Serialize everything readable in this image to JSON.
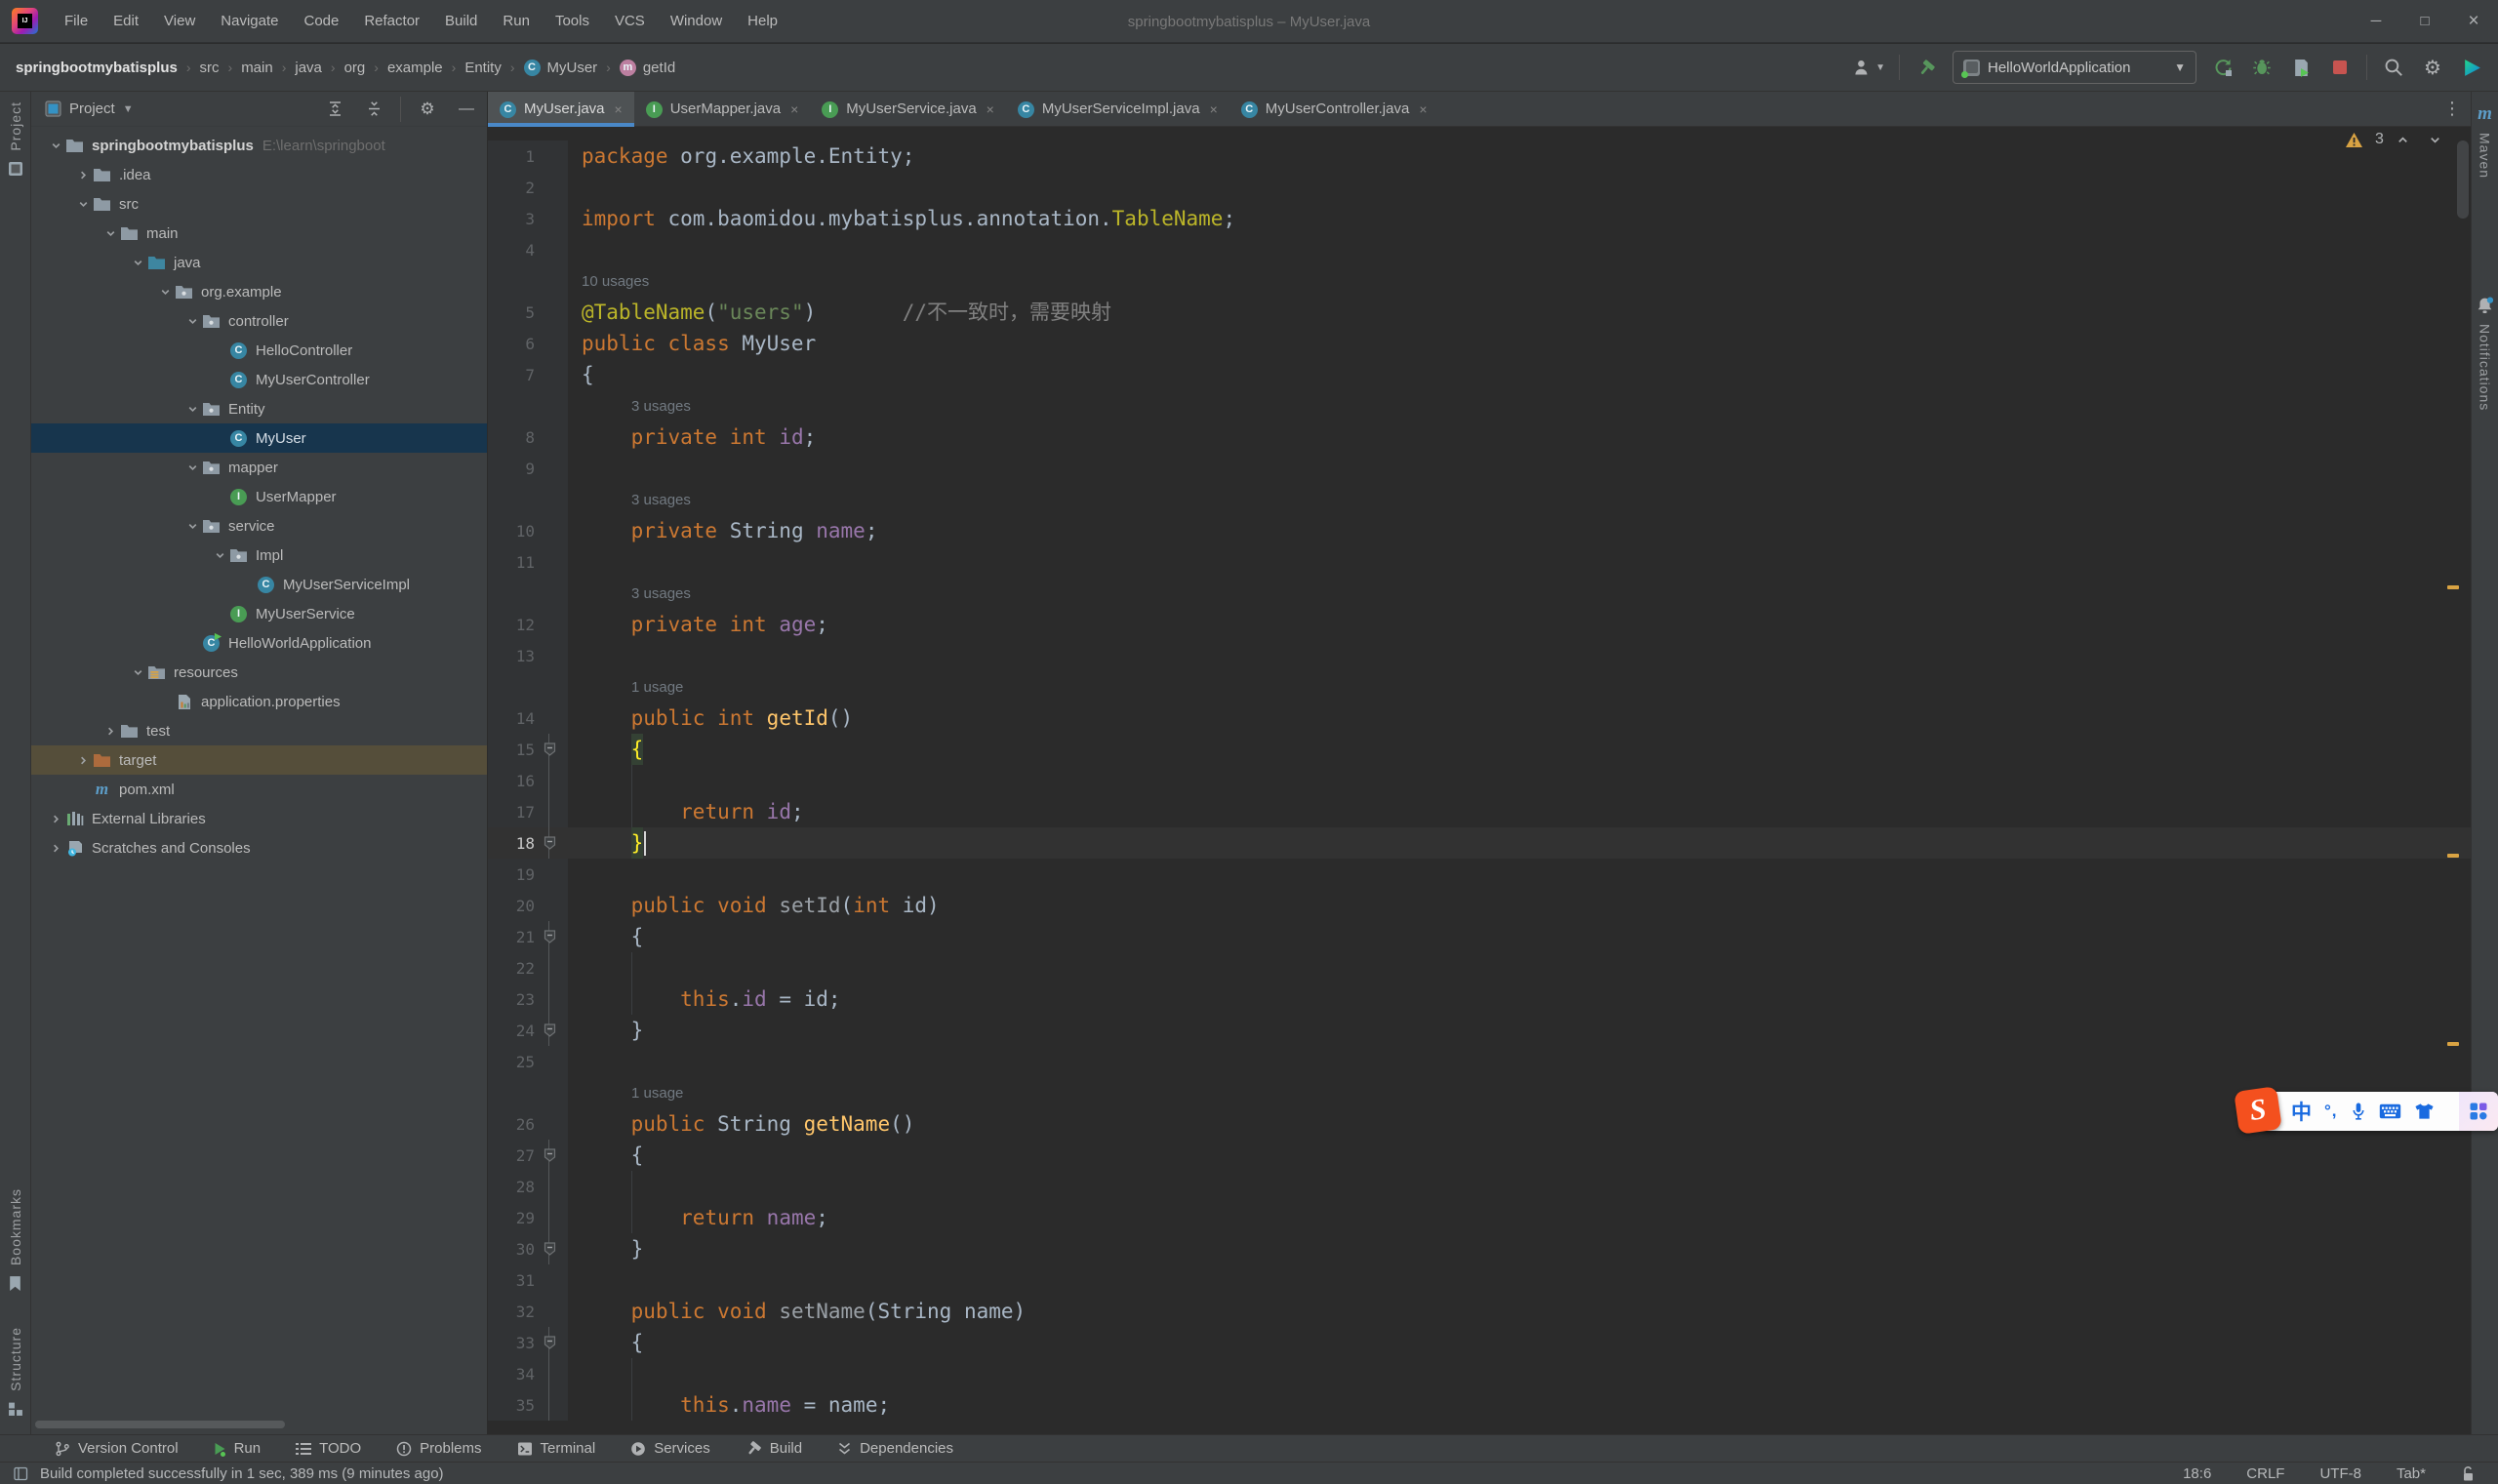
{
  "window": {
    "title": "springbootmybatisplus – MyUser.java",
    "menu": [
      "File",
      "Edit",
      "View",
      "Navigate",
      "Code",
      "Refactor",
      "Build",
      "Run",
      "Tools",
      "VCS",
      "Window",
      "Help"
    ],
    "controls": [
      {
        "name": "minimize",
        "glyph": "─"
      },
      {
        "name": "maximize",
        "glyph": "□"
      },
      {
        "name": "close",
        "glyph": "×"
      }
    ]
  },
  "breadcrumbs": [
    {
      "label": "springbootmybatisplus",
      "bold": true
    },
    {
      "label": "src"
    },
    {
      "label": "main"
    },
    {
      "label": "java"
    },
    {
      "label": "org"
    },
    {
      "label": "example"
    },
    {
      "label": "Entity"
    },
    {
      "label": "MyUser",
      "icon": "class-badge"
    },
    {
      "label": "getId",
      "icon": "method-badge"
    }
  ],
  "run_toolbar": {
    "config_name": "HelloWorldApplication",
    "icons": [
      "user-icon",
      "build-hammer-icon",
      "rerun-icon",
      "debug-icon",
      "profiler-icon",
      "stop-icon",
      "search-icon",
      "settings-gear-icon",
      "ide-logo-icon"
    ]
  },
  "tabs": [
    {
      "label": "MyUser.java",
      "icon": "class",
      "selected": true
    },
    {
      "label": "UserMapper.java",
      "icon": "interface",
      "selected": false
    },
    {
      "label": "MyUserService.java",
      "icon": "interface",
      "selected": false
    },
    {
      "label": "MyUserServiceImpl.java",
      "icon": "class",
      "selected": false
    },
    {
      "label": "MyUserController.java",
      "icon": "class",
      "selected": false
    }
  ],
  "project_panel": {
    "title": "Project",
    "header_icons": [
      "expand-all-icon",
      "collapse-all-icon",
      "settings-gear-icon",
      "hide-icon"
    ],
    "tree": [
      {
        "label": "springbootmybatisplus",
        "extra": "E:\\learn\\springboot",
        "icon": "folder",
        "d": 0,
        "arrow": "open",
        "bold": true
      },
      {
        "label": ".idea",
        "icon": "folder",
        "d": 1,
        "arrow": "closed"
      },
      {
        "label": "src",
        "icon": "folder",
        "d": 1,
        "arrow": "open"
      },
      {
        "label": "main",
        "icon": "folder",
        "d": 2,
        "arrow": "open"
      },
      {
        "label": "java",
        "icon": "folder-src",
        "d": 3,
        "arrow": "open"
      },
      {
        "label": "org.example",
        "icon": "package",
        "d": 4,
        "arrow": "open"
      },
      {
        "label": "controller",
        "icon": "package",
        "d": 5,
        "arrow": "open"
      },
      {
        "label": "HelloController",
        "icon": "class",
        "d": 6
      },
      {
        "label": "MyUserController",
        "icon": "class",
        "d": 6
      },
      {
        "label": "Entity",
        "icon": "package",
        "d": 5,
        "arrow": "open"
      },
      {
        "label": "MyUser",
        "icon": "class",
        "d": 6,
        "selected": true
      },
      {
        "label": "mapper",
        "icon": "package",
        "d": 5,
        "arrow": "open"
      },
      {
        "label": "UserMapper",
        "icon": "interface",
        "d": 6
      },
      {
        "label": "service",
        "icon": "package",
        "d": 5,
        "arrow": "open"
      },
      {
        "label": "Impl",
        "icon": "package",
        "d": 6,
        "arrow": "open"
      },
      {
        "label": "MyUserServiceImpl",
        "icon": "class",
        "d": 7
      },
      {
        "label": "MyUserService",
        "icon": "interface",
        "d": 6
      },
      {
        "label": "HelloWorldApplication",
        "icon": "runclass",
        "d": 5
      },
      {
        "label": "resources",
        "icon": "resources",
        "d": 3,
        "arrow": "open"
      },
      {
        "label": "application.properties",
        "icon": "properties",
        "d": 4
      },
      {
        "label": "test",
        "icon": "folder",
        "d": 2,
        "arrow": "closed"
      },
      {
        "label": "target",
        "icon": "folder-excluded",
        "d": 1,
        "arrow": "closed",
        "highlight": true
      },
      {
        "label": "pom.xml",
        "icon": "maven",
        "d": 1
      },
      {
        "label": "External Libraries",
        "icon": "extlib",
        "d": 0,
        "arrow": "closed"
      },
      {
        "label": "Scratches and Consoles",
        "icon": "scratches",
        "d": 0,
        "arrow": "closed"
      }
    ]
  },
  "editor": {
    "inspection_warnings": "3",
    "rows": [
      {
        "n": "1",
        "seg": [
          [
            "k",
            "package"
          ],
          [
            "t",
            " org.example.Entity;"
          ]
        ]
      },
      {
        "n": "2",
        "seg": []
      },
      {
        "n": "3",
        "seg": [
          [
            "k",
            "import"
          ],
          [
            "t",
            " com.baomidou.mybatisplus.annotation."
          ],
          [
            "a",
            "TableName"
          ],
          [
            "t",
            ";"
          ]
        ]
      },
      {
        "n": "4",
        "seg": []
      },
      {
        "inlay": "10 usages",
        "ind": 0
      },
      {
        "n": "5",
        "seg": [
          [
            "a",
            "@TableName"
          ],
          [
            "t",
            "("
          ],
          [
            "s",
            "\"users\""
          ],
          [
            "t",
            ")       "
          ],
          [
            "c",
            "//不一致时，需要映射"
          ]
        ]
      },
      {
        "n": "6",
        "seg": [
          [
            "k",
            "public class"
          ],
          [
            "t",
            " MyUser"
          ]
        ]
      },
      {
        "n": "7",
        "seg": [
          [
            "t",
            "{"
          ]
        ]
      },
      {
        "inlay": "3 usages",
        "ind": 1
      },
      {
        "n": "8",
        "seg": [
          [
            "t",
            "    "
          ],
          [
            "k",
            "private int"
          ],
          [
            "t",
            " "
          ],
          [
            "f",
            "id"
          ],
          [
            "t",
            ";"
          ]
        ]
      },
      {
        "n": "9",
        "seg": []
      },
      {
        "inlay": "3 usages",
        "ind": 1
      },
      {
        "n": "10",
        "seg": [
          [
            "t",
            "    "
          ],
          [
            "k",
            "private"
          ],
          [
            "t",
            " String "
          ],
          [
            "f",
            "name"
          ],
          [
            "t",
            ";"
          ]
        ]
      },
      {
        "n": "11",
        "seg": []
      },
      {
        "inlay": "3 usages",
        "ind": 1
      },
      {
        "n": "12",
        "seg": [
          [
            "t",
            "    "
          ],
          [
            "k",
            "private int"
          ],
          [
            "t",
            " "
          ],
          [
            "f",
            "age"
          ],
          [
            "t",
            ";"
          ]
        ]
      },
      {
        "n": "13",
        "seg": []
      },
      {
        "inlay": "1 usage",
        "ind": 1
      },
      {
        "n": "14",
        "seg": [
          [
            "t",
            "    "
          ],
          [
            "k",
            "public int"
          ],
          [
            "t",
            " "
          ],
          [
            "m",
            "getId"
          ],
          [
            "t",
            "()"
          ]
        ]
      },
      {
        "n": "15",
        "seg": [
          [
            "t",
            "    "
          ],
          [
            "b",
            "{"
          ]
        ],
        "f": 1,
        "fl": 1
      },
      {
        "n": "16",
        "seg": [],
        "g": 1,
        "fl": 1
      },
      {
        "n": "17",
        "seg": [
          [
            "t",
            "        "
          ],
          [
            "k",
            "return"
          ],
          [
            "t",
            " "
          ],
          [
            "f",
            "id"
          ],
          [
            "t",
            ";"
          ]
        ],
        "g": 1,
        "fl": 1
      },
      {
        "n": "18",
        "seg": [
          [
            "t",
            "    "
          ],
          [
            "b",
            "}"
          ],
          [
            "caret",
            ""
          ]
        ],
        "f": 1,
        "fl": 1,
        "cur": 1
      },
      {
        "n": "19",
        "seg": []
      },
      {
        "n": "20",
        "seg": [
          [
            "t",
            "    "
          ],
          [
            "k",
            "public void"
          ],
          [
            "t",
            " "
          ],
          [
            "d",
            "setId"
          ],
          [
            "t",
            "("
          ],
          [
            "k",
            "int"
          ],
          [
            "t",
            " id)"
          ]
        ]
      },
      {
        "n": "21",
        "seg": [
          [
            "t",
            "    {"
          ]
        ],
        "f": 1,
        "fl": 1
      },
      {
        "n": "22",
        "seg": [],
        "g": 1,
        "fl": 1
      },
      {
        "n": "23",
        "seg": [
          [
            "t",
            "        "
          ],
          [
            "k",
            "this"
          ],
          [
            "t",
            "."
          ],
          [
            "f",
            "id"
          ],
          [
            "t",
            " = id;"
          ]
        ],
        "g": 1,
        "fl": 1
      },
      {
        "n": "24",
        "seg": [
          [
            "t",
            "    }"
          ]
        ],
        "f": 1,
        "fl": 1
      },
      {
        "n": "25",
        "seg": []
      },
      {
        "inlay": "1 usage",
        "ind": 1
      },
      {
        "n": "26",
        "seg": [
          [
            "t",
            "    "
          ],
          [
            "k",
            "public"
          ],
          [
            "t",
            " String "
          ],
          [
            "m",
            "getName"
          ],
          [
            "t",
            "()"
          ]
        ]
      },
      {
        "n": "27",
        "seg": [
          [
            "t",
            "    {"
          ]
        ],
        "f": 1,
        "fl": 1
      },
      {
        "n": "28",
        "seg": [],
        "g": 1,
        "fl": 1
      },
      {
        "n": "29",
        "seg": [
          [
            "t",
            "        "
          ],
          [
            "k",
            "return"
          ],
          [
            "t",
            " "
          ],
          [
            "f",
            "name"
          ],
          [
            "t",
            ";"
          ]
        ],
        "g": 1,
        "fl": 1
      },
      {
        "n": "30",
        "seg": [
          [
            "t",
            "    }"
          ]
        ],
        "f": 1,
        "fl": 1
      },
      {
        "n": "31",
        "seg": []
      },
      {
        "n": "32",
        "seg": [
          [
            "t",
            "    "
          ],
          [
            "k",
            "public void"
          ],
          [
            "t",
            " "
          ],
          [
            "d",
            "setName"
          ],
          [
            "t",
            "(String name)"
          ]
        ]
      },
      {
        "n": "33",
        "seg": [
          [
            "t",
            "    {"
          ]
        ],
        "f": 1,
        "fl": 1
      },
      {
        "n": "34",
        "seg": [],
        "g": 1,
        "fl": 1
      },
      {
        "n": "35",
        "seg": [
          [
            "t",
            "        "
          ],
          [
            "k",
            "this"
          ],
          [
            "t",
            "."
          ],
          [
            "f",
            "name"
          ],
          [
            "t",
            " = name;"
          ]
        ],
        "g": 1,
        "fl": 1
      }
    ],
    "error_stripe_marks_y": [
      506,
      781,
      974
    ]
  },
  "tool_buttons_bottom": [
    {
      "label": "Version Control",
      "icon": "branch-icon"
    },
    {
      "label": "Run",
      "icon": "run-play-icon"
    },
    {
      "label": "TODO",
      "icon": "todo-list-icon"
    },
    {
      "label": "Problems",
      "icon": "problems-icon"
    },
    {
      "label": "Terminal",
      "icon": "terminal-icon"
    },
    {
      "label": "Services",
      "icon": "services-icon"
    },
    {
      "label": "Build",
      "icon": "build-hammer-icon"
    },
    {
      "label": "Dependencies",
      "icon": "dependencies-icon"
    }
  ],
  "status_bar": {
    "message": "Build completed successfully in 1 sec, 389 ms (9 minutes ago)",
    "caret_position": "18:6",
    "line_separator": "CRLF",
    "encoding": "UTF-8",
    "indent": "Tab*"
  },
  "left_stripe": [
    {
      "label": "Project",
      "icon": "project-tool-icon"
    },
    {
      "label": "Bookmarks",
      "icon": "bookmark-icon"
    },
    {
      "label": "Structure",
      "icon": "structure-icon"
    }
  ],
  "right_stripe": [
    {
      "label": "Maven",
      "icon": "maven-icon"
    },
    {
      "label": "Notifications",
      "icon": "bell-icon"
    }
  ],
  "ime_bar": {
    "name": "Sogou input toolbar",
    "logo_letter": "S",
    "chinese_label": "中",
    "punct_label": "°,",
    "icons": [
      "chinese-mode-icon",
      "punctuation-icon",
      "microphone-icon",
      "keyboard-icon",
      "skin-icon",
      "toolbox-icon"
    ]
  },
  "colors": {
    "accent_blue": "#4A88C7",
    "warning_yellow": "#D9A343",
    "stop_red": "#C75450",
    "run_green": "#499C54",
    "class_badge": "#3786A3",
    "interface_badge": "#499C54",
    "method_badge": "#BC7FA0",
    "sogou_orange": "#F4501E",
    "ime_blue": "#1A6BE0",
    "editor_bg": "#2B2B2B",
    "panel_bg": "#3C3F41",
    "selection_blue": "#17354D",
    "excluded_row": "#554E3A"
  }
}
